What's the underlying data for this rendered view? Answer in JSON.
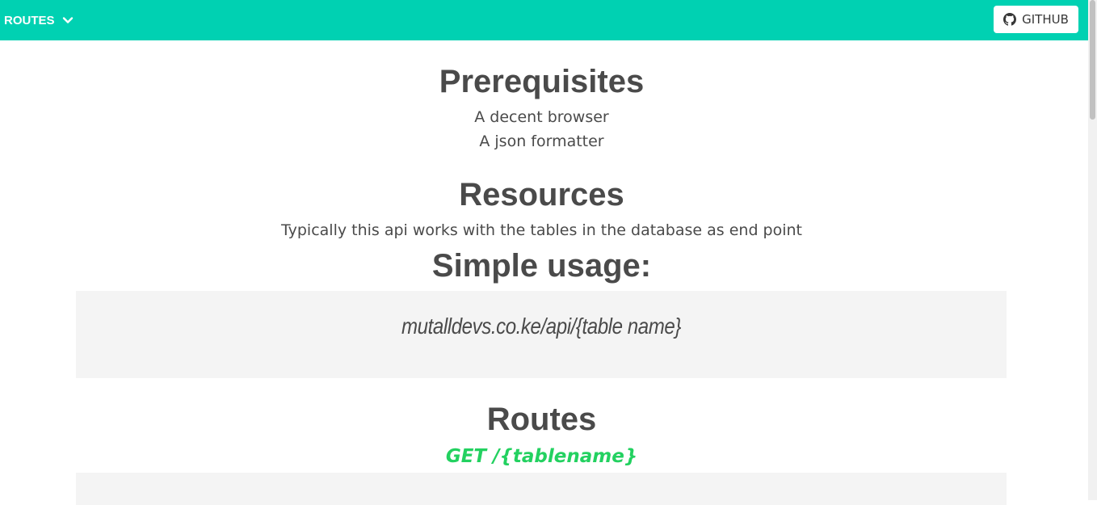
{
  "navbar": {
    "menu_label": "ROUTES",
    "menu_icon": "chevron-down-icon",
    "github_label": "GITHUB",
    "github_icon": "github-icon",
    "background": "#00d1b2"
  },
  "sections": {
    "prerequisites": {
      "title": "Prerequisites",
      "items": [
        "A decent browser",
        "A json formatter"
      ]
    },
    "resources": {
      "title": "Resources",
      "description": "Typically this api works with the tables in the database as end point"
    },
    "simple_usage": {
      "title": "Simple usage:",
      "example": "mutalldevs.co.ke/api/{table name}"
    },
    "routes": {
      "title": "Routes",
      "first_route": "GET /{tablename}",
      "route_color": "#23d160"
    }
  }
}
